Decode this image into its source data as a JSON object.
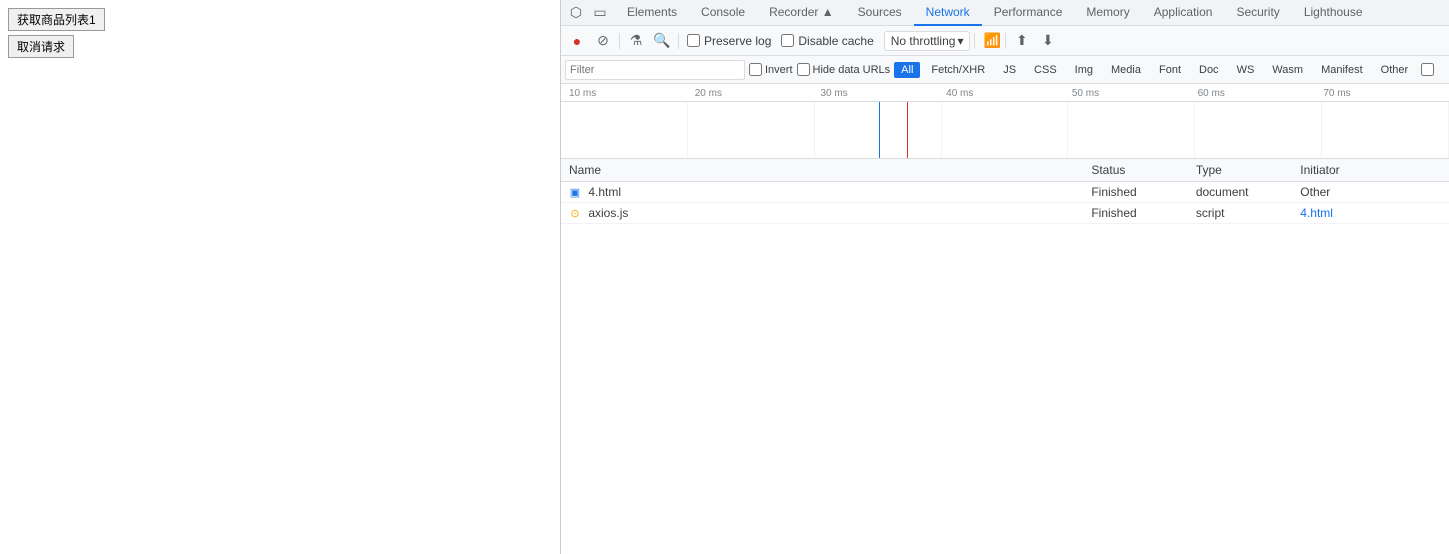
{
  "page": {
    "buttons": [
      {
        "label": "获取商品列表1"
      },
      {
        "label": "取消请求"
      }
    ]
  },
  "devtools": {
    "tabs": [
      {
        "label": "Elements",
        "active": false
      },
      {
        "label": "Console",
        "active": false
      },
      {
        "label": "Recorder ▲",
        "active": false
      },
      {
        "label": "Sources",
        "active": false
      },
      {
        "label": "Network",
        "active": true
      },
      {
        "label": "Performance",
        "active": false
      },
      {
        "label": "Memory",
        "active": false
      },
      {
        "label": "Application",
        "active": false
      },
      {
        "label": "Security",
        "active": false
      },
      {
        "label": "Lighthouse",
        "active": false
      }
    ],
    "toolbar": {
      "preserve_log": "Preserve log",
      "disable_cache": "Disable cache",
      "throttling": "No throttling"
    },
    "filter": {
      "placeholder": "Filter",
      "invert": "Invert",
      "hide_data_urls": "Hide data URLs",
      "types": [
        "All",
        "Fetch/XHR",
        "JS",
        "CSS",
        "Img",
        "Media",
        "Font",
        "Doc",
        "WS",
        "Wasm",
        "Manifest",
        "Other"
      ]
    },
    "timeline": {
      "ticks": [
        "10 ms",
        "20 ms",
        "30 ms",
        "40 ms",
        "50 ms",
        "60 ms",
        "70 ms"
      ]
    },
    "network_table": {
      "headers": [
        "Name",
        "Status",
        "Type",
        "Initiator"
      ],
      "rows": [
        {
          "icon": "html",
          "name": "4.html",
          "status": "Finished",
          "type": "document",
          "initiator": "Other"
        },
        {
          "icon": "js",
          "name": "axios.js",
          "status": "Finished",
          "type": "script",
          "initiator": "4.html"
        }
      ]
    }
  }
}
